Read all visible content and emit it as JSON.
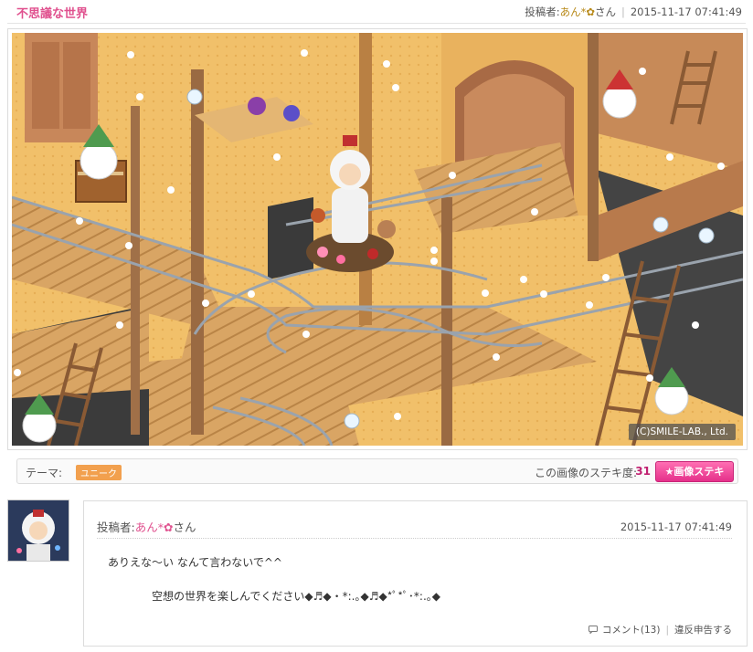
{
  "header": {
    "title": "不思議な世界",
    "poster_label": "投稿者:",
    "poster_name": "あん*✿",
    "poster_suffix": "さん",
    "separator": "|",
    "datetime": "2015-11-17 07:41:49"
  },
  "image": {
    "copyright": "(C)SMILE-LAB., Ltd."
  },
  "theme_bar": {
    "theme_label": "テーマ:",
    "theme_badge": "ユニーク",
    "steki_label": "この画像のステキ度:",
    "steki_count": "31",
    "steki_button": "★画像ステキ",
    "colors": {
      "badge": "#f2a04e",
      "button": "#e5308a",
      "count": "#c02070"
    }
  },
  "comment": {
    "poster_label": "投稿者:",
    "poster_name": "あん*✿",
    "poster_suffix": "さん",
    "datetime": "2015-11-17 07:41:49",
    "line1": "ありえな〜い なんて言わないで^^",
    "line2": "空想の世界を楽しんでください◆♬◆・*:.｡◆♬◆*ﾟ*ﾟ･*:.｡◆",
    "comment_link": "コメント(13)",
    "separator": "|",
    "report_link": "違反申告する",
    "icons": [
      "speech-bubble-icon"
    ]
  }
}
